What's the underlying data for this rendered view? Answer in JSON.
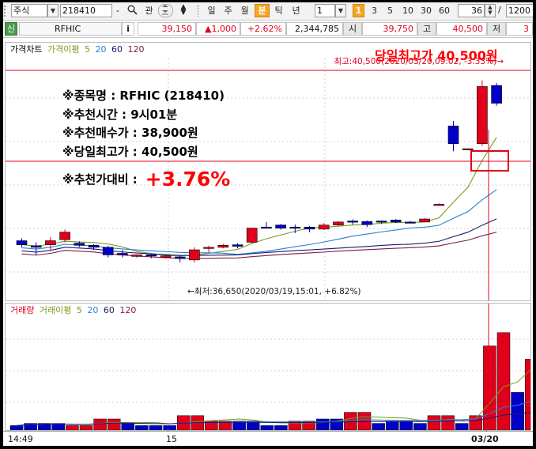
{
  "toolbar": {
    "market_type": "주식",
    "code": "218410",
    "search_icon": "search-icon",
    "relation": "관",
    "period_buttons": [
      "일",
      "주",
      "월",
      "분",
      "틱",
      "년"
    ],
    "selected_period": "분",
    "interval_value": "1",
    "minute_buttons": [
      "1",
      "3",
      "5",
      "10",
      "30",
      "60"
    ],
    "selected_minute": "1",
    "count_value": "36",
    "slash": "/",
    "total_value": "1200"
  },
  "quote": {
    "tag": "신",
    "name": "RFHIC",
    "info": "i",
    "price": "39,150",
    "change": "▲1,000",
    "change_pct": "+2.62%",
    "volume": "2,344,785",
    "open_label": "시",
    "open": "39,750",
    "high_label": "고",
    "high": "40,500",
    "low_label": "저",
    "low": "3"
  },
  "price_panel": {
    "legend": {
      "title": "가격차트",
      "ma_label": "가격이평",
      "ma5": "5",
      "ma20": "20",
      "ma60": "60",
      "ma120": "120"
    },
    "max_note": "최고:40,500(2020/03/20,09:02, -3.33%)→",
    "min_note": "←최저:36,650(2020/03/19,15:01, +6.82%)"
  },
  "annotation": {
    "headline": "당일최고가 40,500원",
    "lines": [
      "※종목명 : RFHIC (218410)",
      "※추천시간 : 9시01분",
      "※추천매수가 : 38,900원",
      "※당일최고가 : 40,500원"
    ],
    "ratio_label": "※추천가대비 :",
    "ratio_value": "+3.76%"
  },
  "volume_panel": {
    "legend": {
      "title": "거래량",
      "ma_label": "거래이평",
      "ma5": "5",
      "ma20": "20",
      "ma60": "60",
      "ma120": "120"
    }
  },
  "x_axis": {
    "labels": [
      "14:49",
      "15",
      "03/20"
    ]
  },
  "colors": {
    "up": "#e0001b",
    "down": "#0000c8",
    "ma5": "#7a9a1a",
    "ma20": "#2a7fd5",
    "ma60": "#1a1a6e",
    "ma120": "#7a1a4a",
    "annotation": "#ff0000"
  },
  "chart_data": {
    "type": "candlestick",
    "price_range": [
      36400,
      40700
    ],
    "candles": [
      {
        "o": 37330,
        "c": 37250,
        "h": 37380,
        "l": 37200
      },
      {
        "o": 37230,
        "c": 37200,
        "h": 37300,
        "l": 37050
      },
      {
        "o": 37250,
        "c": 37330,
        "h": 37400,
        "l": 37150
      },
      {
        "o": 37350,
        "c": 37500,
        "h": 37550,
        "l": 37300
      },
      {
        "o": 37280,
        "c": 37240,
        "h": 37320,
        "l": 37200
      },
      {
        "o": 37240,
        "c": 37200,
        "h": 37260,
        "l": 37150
      },
      {
        "o": 37200,
        "c": 37050,
        "h": 37230,
        "l": 37000
      },
      {
        "o": 37080,
        "c": 37050,
        "h": 37150,
        "l": 37000
      },
      {
        "o": 37020,
        "c": 37050,
        "h": 37060,
        "l": 36990
      },
      {
        "o": 37050,
        "c": 37030,
        "h": 37070,
        "l": 36980
      },
      {
        "o": 37000,
        "c": 37030,
        "h": 37060,
        "l": 36980
      },
      {
        "o": 37010,
        "c": 36980,
        "h": 37050,
        "l": 36900
      },
      {
        "o": 36950,
        "c": 37150,
        "h": 37200,
        "l": 36900
      },
      {
        "o": 37180,
        "c": 37200,
        "h": 37230,
        "l": 37100
      },
      {
        "o": 37200,
        "c": 37240,
        "h": 37270,
        "l": 37180
      },
      {
        "o": 37250,
        "c": 37220,
        "h": 37280,
        "l": 37180
      },
      {
        "o": 37300,
        "c": 37580,
        "h": 37580,
        "l": 37270
      },
      {
        "o": 37600,
        "c": 37600,
        "h": 37700,
        "l": 37570
      },
      {
        "o": 37640,
        "c": 37580,
        "h": 37660,
        "l": 37550
      },
      {
        "o": 37600,
        "c": 37600,
        "h": 37650,
        "l": 37480
      },
      {
        "o": 37600,
        "c": 37560,
        "h": 37620,
        "l": 37500
      },
      {
        "o": 37560,
        "c": 37640,
        "h": 37680,
        "l": 37540
      },
      {
        "o": 37640,
        "c": 37700,
        "h": 37720,
        "l": 37620
      },
      {
        "o": 37720,
        "c": 37700,
        "h": 37750,
        "l": 37650
      },
      {
        "o": 37710,
        "c": 37650,
        "h": 37730,
        "l": 37600
      },
      {
        "o": 37720,
        "c": 37700,
        "h": 37730,
        "l": 37660
      },
      {
        "o": 37740,
        "c": 37700,
        "h": 37760,
        "l": 37680
      },
      {
        "o": 37700,
        "c": 37700,
        "h": 37720,
        "l": 37680
      },
      {
        "o": 37700,
        "c": 37760,
        "h": 37780,
        "l": 37700
      },
      {
        "o": 38050,
        "c": 38050,
        "h": 38070,
        "l": 38040
      },
      {
        "o": 39600,
        "c": 39250,
        "h": 39700,
        "l": 39100
      },
      {
        "o": 39150,
        "c": 39150,
        "h": 39150,
        "l": 39150
      },
      {
        "o": 39250,
        "c": 40380,
        "h": 40500,
        "l": 39200
      },
      {
        "o": 40400,
        "c": 40050,
        "h": 40450,
        "l": 40000
      }
    ],
    "volume_range": [
      0,
      100
    ],
    "volumes": [
      4,
      6,
      6,
      6,
      4,
      4,
      10,
      10,
      6,
      4,
      4,
      4,
      13,
      13,
      8,
      8,
      8,
      8,
      4,
      4,
      8,
      8,
      10,
      10,
      16,
      16,
      6,
      8,
      8,
      6,
      13,
      13,
      6,
      13,
      76,
      88,
      34,
      64,
      26
    ],
    "volume_colors": [
      "d",
      "d",
      "d",
      "d",
      "u",
      "u",
      "u",
      "u",
      "d",
      "d",
      "d",
      "d",
      "u",
      "u",
      "u",
      "u",
      "d",
      "d",
      "d",
      "d",
      "u",
      "u",
      "d",
      "d",
      "u",
      "u",
      "d",
      "d",
      "d",
      "d",
      "u",
      "u",
      "d",
      "u",
      "u",
      "u",
      "d",
      "u",
      "d"
    ]
  }
}
